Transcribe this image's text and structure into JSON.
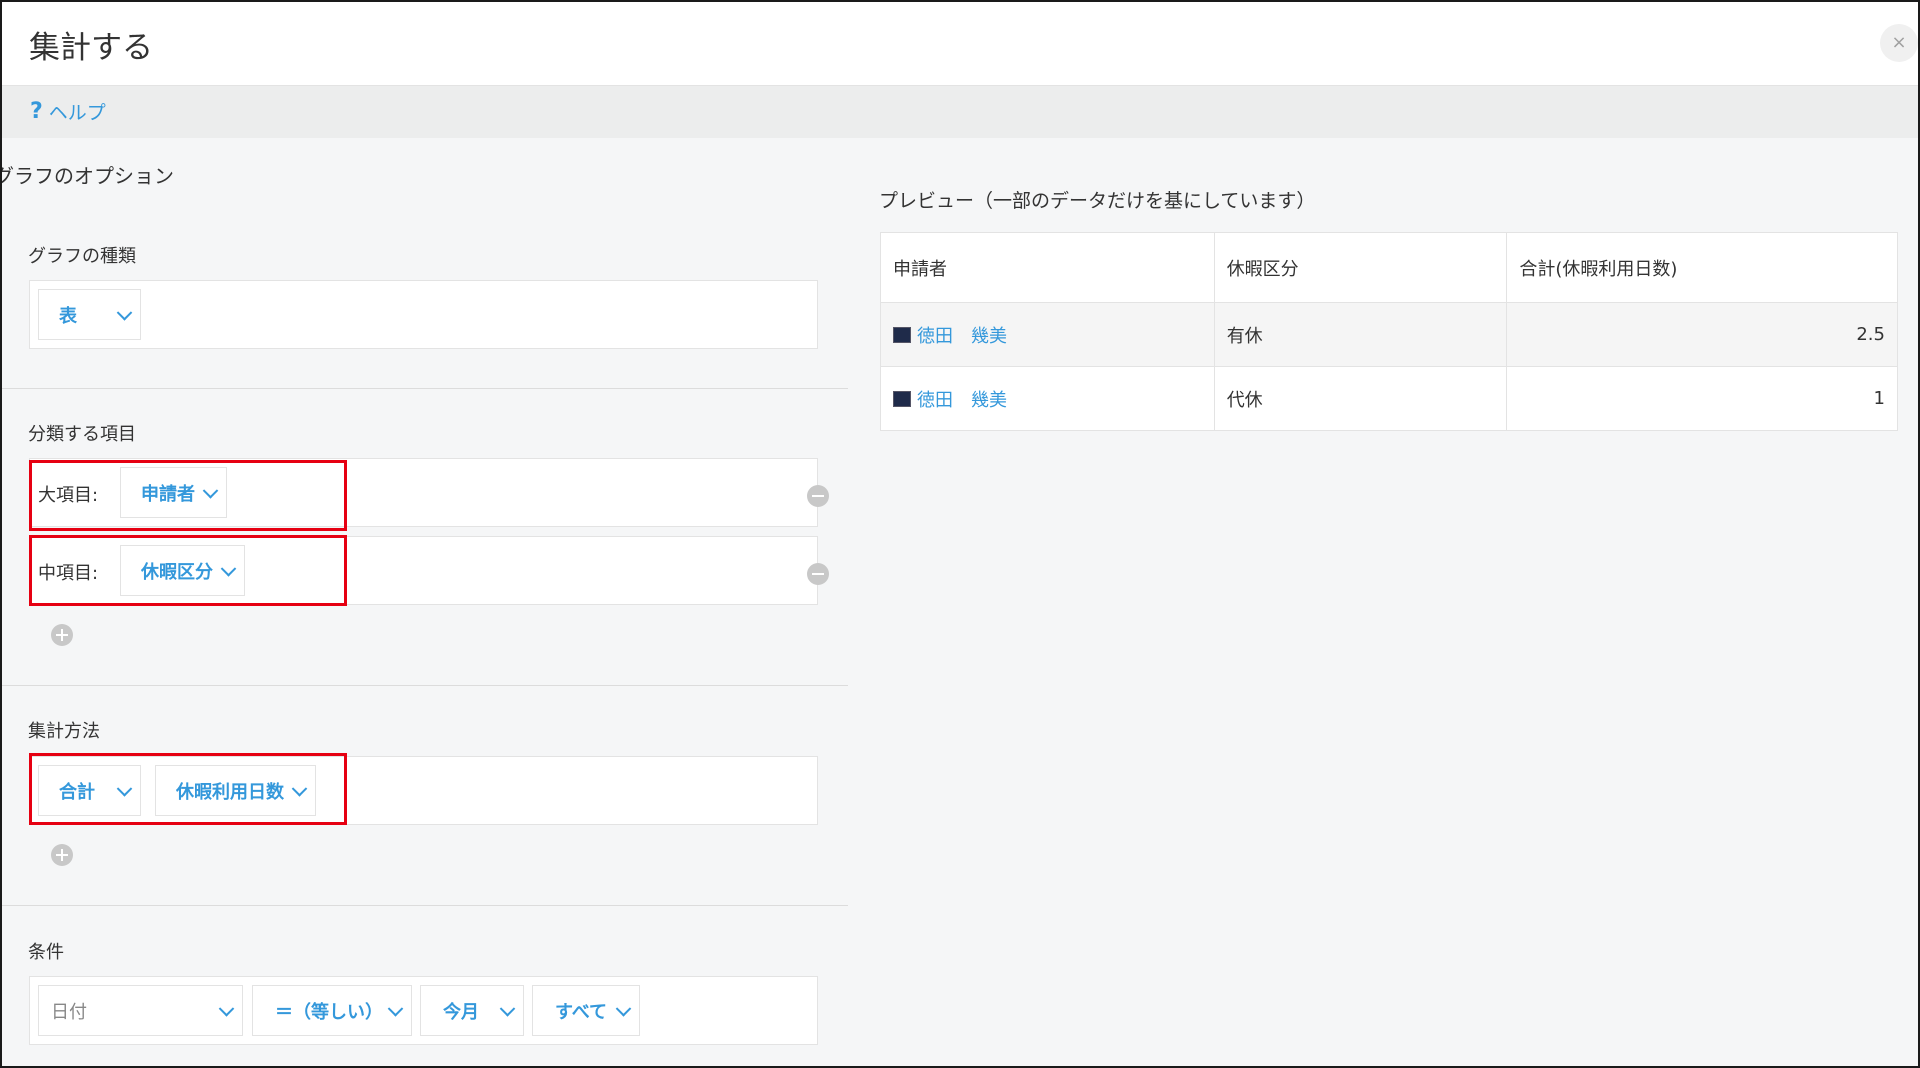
{
  "window": {
    "title": "集計する",
    "close_label": "×"
  },
  "help": {
    "label": "ヘルプ",
    "icon": "question-icon"
  },
  "options_title": "グラフのオプション",
  "graph_type": {
    "label": "グラフの種類",
    "selected": "表"
  },
  "grouping": {
    "label": "分類する項目",
    "rows": [
      {
        "label": "大項目:",
        "value": "申請者"
      },
      {
        "label": "中項目:",
        "value": "休暇区分"
      }
    ]
  },
  "aggregation": {
    "label": "集計方法",
    "method": "合計",
    "field": "休暇利用日数"
  },
  "conditions": {
    "label": "条件",
    "field": "日付",
    "operator": "＝（等しい）",
    "value": "今月",
    "scope": "すべて"
  },
  "preview": {
    "title": "プレビュー（一部のデータだけを基にしています）",
    "columns": [
      "申請者",
      "休暇区分",
      "合計(休暇利用日数)"
    ],
    "rows": [
      {
        "applicant": "徳田　幾美",
        "leave_type": "有休",
        "total": "2.5"
      },
      {
        "applicant": "徳田　幾美",
        "leave_type": "代休",
        "total": "1"
      }
    ]
  },
  "colors": {
    "accent": "#3498db",
    "highlight": "#e60012"
  }
}
